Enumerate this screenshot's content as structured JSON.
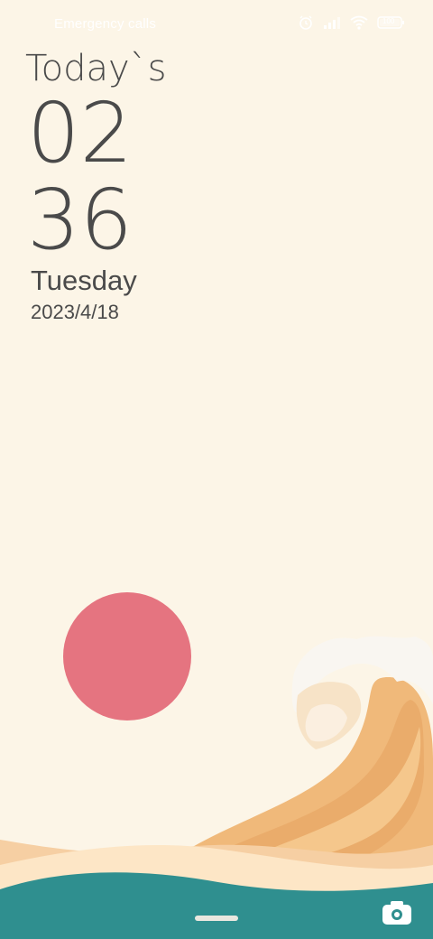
{
  "status_bar": {
    "left_text": "Emergency calls",
    "icons": [
      "alarm-icon",
      "signal-icon",
      "wifi-icon",
      "battery-icon"
    ],
    "battery_level": "100"
  },
  "clock": {
    "title": "Today`s",
    "hour": "02",
    "minute": "36",
    "weekday": "Tuesday",
    "date": "2023/4/18"
  },
  "wallpaper": {
    "sun_color": "#e57480",
    "sky_color": "#fcf5e7",
    "sea_color": "#2f8f8f"
  },
  "bottom": {
    "icons": [
      "home-indicator",
      "camera-icon"
    ]
  }
}
